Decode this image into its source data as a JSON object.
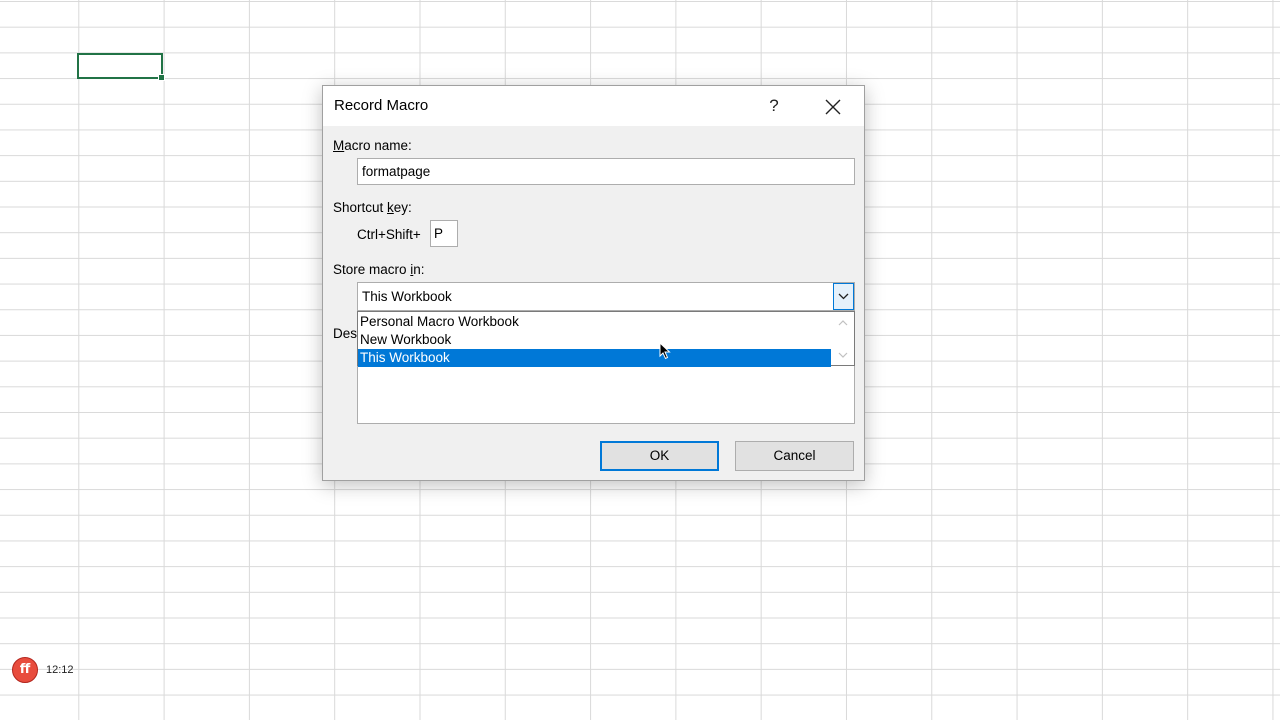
{
  "dialog": {
    "title": "Record Macro",
    "help_label": "?",
    "macro_name": {
      "label_accel": "M",
      "label_rest": "acro name:",
      "value": "formatpage"
    },
    "shortcut": {
      "label_pre": "Shortcut ",
      "label_accel": "k",
      "label_post": "ey:",
      "prefix": "Ctrl+Shift+",
      "key_value": "P"
    },
    "store": {
      "label_pre": "Store macro ",
      "label_accel": "i",
      "label_post": "n:",
      "selected": "This Workbook",
      "options": [
        "Personal Macro Workbook",
        "New Workbook",
        "This Workbook"
      ]
    },
    "description": {
      "label_visible": "Des"
    },
    "ok_label": "OK",
    "cancel_label": "Cancel"
  },
  "recorder": {
    "logo_text": "ff",
    "time": "12:12"
  },
  "colors": {
    "accent": "#0078d7",
    "cell_border": "#217346",
    "recorder": "#e84c3d"
  }
}
